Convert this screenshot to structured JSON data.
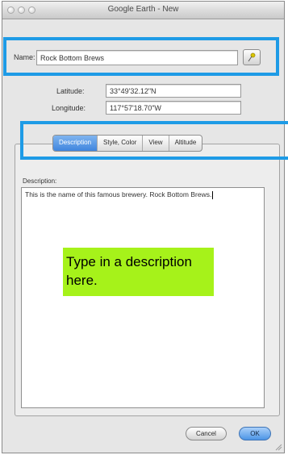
{
  "window": {
    "title": "Google Earth - New"
  },
  "form": {
    "name_label": "Name:",
    "name_value": "Rock Bottom Brews",
    "latitude_label": "Latitude:",
    "latitude_value": "33°49'32.12\"N",
    "longitude_label": "Longitude:",
    "longitude_value": "117°57'18.70\"W"
  },
  "tabs": [
    {
      "label": "Description",
      "active": true
    },
    {
      "label": "Style, Color",
      "active": false
    },
    {
      "label": "View",
      "active": false
    },
    {
      "label": "Altitude",
      "active": false
    }
  ],
  "description": {
    "label": "Description:",
    "value": "This is the name of this famous brewery. Rock Bottom Brews."
  },
  "callout": {
    "text": "Type in a description here."
  },
  "buttons": {
    "cancel": "Cancel",
    "ok": "OK"
  },
  "colors": {
    "highlight": "#1e9be6",
    "callout_bg": "#a6f21a",
    "active_tab": "#3f85de"
  },
  "icons": {
    "pin": "pushpin-icon"
  }
}
